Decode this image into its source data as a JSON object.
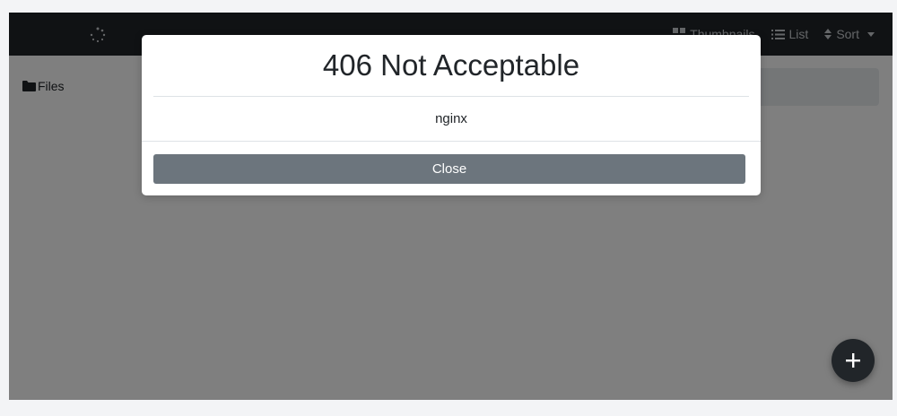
{
  "navbar": {
    "spinner_icon": "loading-spinner-icon",
    "thumbnails_label": "Thumbnails",
    "list_label": "List",
    "sort_label": "Sort"
  },
  "sidebar": {
    "items": [
      {
        "label": "Files",
        "icon": "folder-icon"
      }
    ]
  },
  "fab": {
    "label": "+"
  },
  "modal": {
    "title": "406 Not Acceptable",
    "body": "nginx",
    "close_label": "Close"
  },
  "colors": {
    "navbar_bg": "#212529",
    "button_secondary": "#6c757d",
    "backdrop": "rgba(0,0,0,0.5)"
  }
}
